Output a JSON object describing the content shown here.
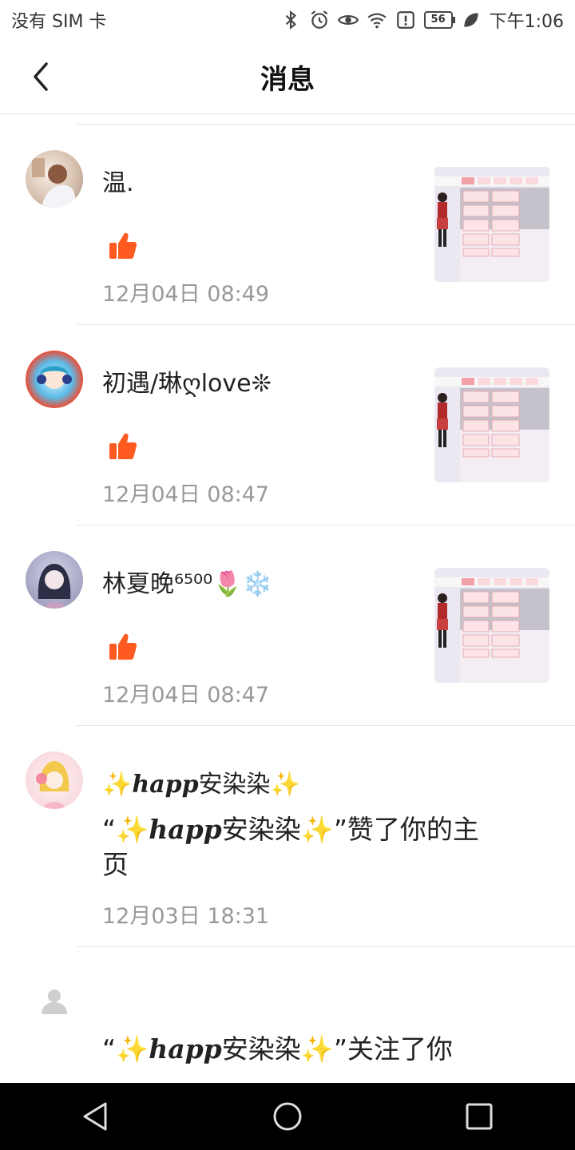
{
  "status_bar": {
    "carrier": "没有 SIM 卡",
    "battery": "56",
    "time": "下午1:06"
  },
  "header": {
    "title": "消息"
  },
  "messages": [
    {
      "name": "温.",
      "time": "12月04日 08:49"
    },
    {
      "name": "初遇/琳ღlove❊",
      "time": "12月04日 08:47"
    },
    {
      "name": "林夏晚⁶⁵⁰⁰🌷❄️",
      "time": "12月04日 08:47"
    },
    {
      "name_sparkle_left": "✨",
      "name_script": "happ",
      "name_text": "安染染",
      "name_sparkle_right": "✨",
      "content_open_quote": "“",
      "content_close_quote": "”赞了你的主页",
      "time": "12月03日 18:31"
    },
    {
      "content_open_quote": "“",
      "content_close_quote": "”关注了你"
    }
  ],
  "colors": {
    "like": "#ff5a1f",
    "sparkle": "#f5c400",
    "divider": "#e6e6e6",
    "time": "#999999"
  }
}
